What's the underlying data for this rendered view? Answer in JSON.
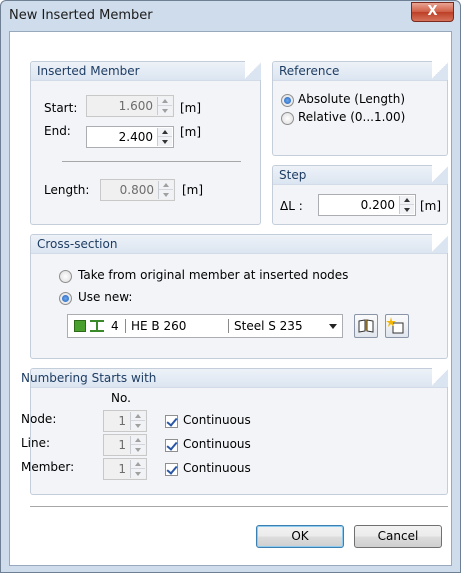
{
  "window": {
    "title": "New Inserted Member",
    "close_glyph": "X"
  },
  "inserted_member": {
    "title": "Inserted Member",
    "start_label": "Start:",
    "start_value": "1.600",
    "start_unit": "[m]",
    "end_label": "End:",
    "end_value": "2.400",
    "end_unit": "[m]",
    "length_label": "Length:",
    "length_value": "0.800",
    "length_unit": "[m]"
  },
  "reference": {
    "title": "Reference",
    "options": [
      "Absolute (Length)",
      "Relative (0...1.00)"
    ],
    "selected": "Absolute (Length)"
  },
  "step": {
    "title": "Step",
    "label": "ΔL :",
    "value": "0.200",
    "unit": "[m]"
  },
  "cross_section": {
    "title": "Cross-section",
    "option_original": "Take from original member at inserted nodes",
    "option_new": "Use new:",
    "selected": "Use new:",
    "number": "4",
    "profile": "HE B 260",
    "material": "Steel S 235",
    "swatch_color": "#4aa02c"
  },
  "numbering": {
    "title": "Numbering Starts with",
    "no_header": "No.",
    "rows": [
      {
        "label": "Node:",
        "value": "1",
        "continuous": "Continuous"
      },
      {
        "label": "Line:",
        "value": "1",
        "continuous": "Continuous"
      },
      {
        "label": "Member:",
        "value": "1",
        "continuous": "Continuous"
      }
    ]
  },
  "buttons": {
    "ok": "OK",
    "cancel": "Cancel"
  },
  "colors": {
    "accent": "#1e3d63",
    "close": "#c94a33"
  }
}
